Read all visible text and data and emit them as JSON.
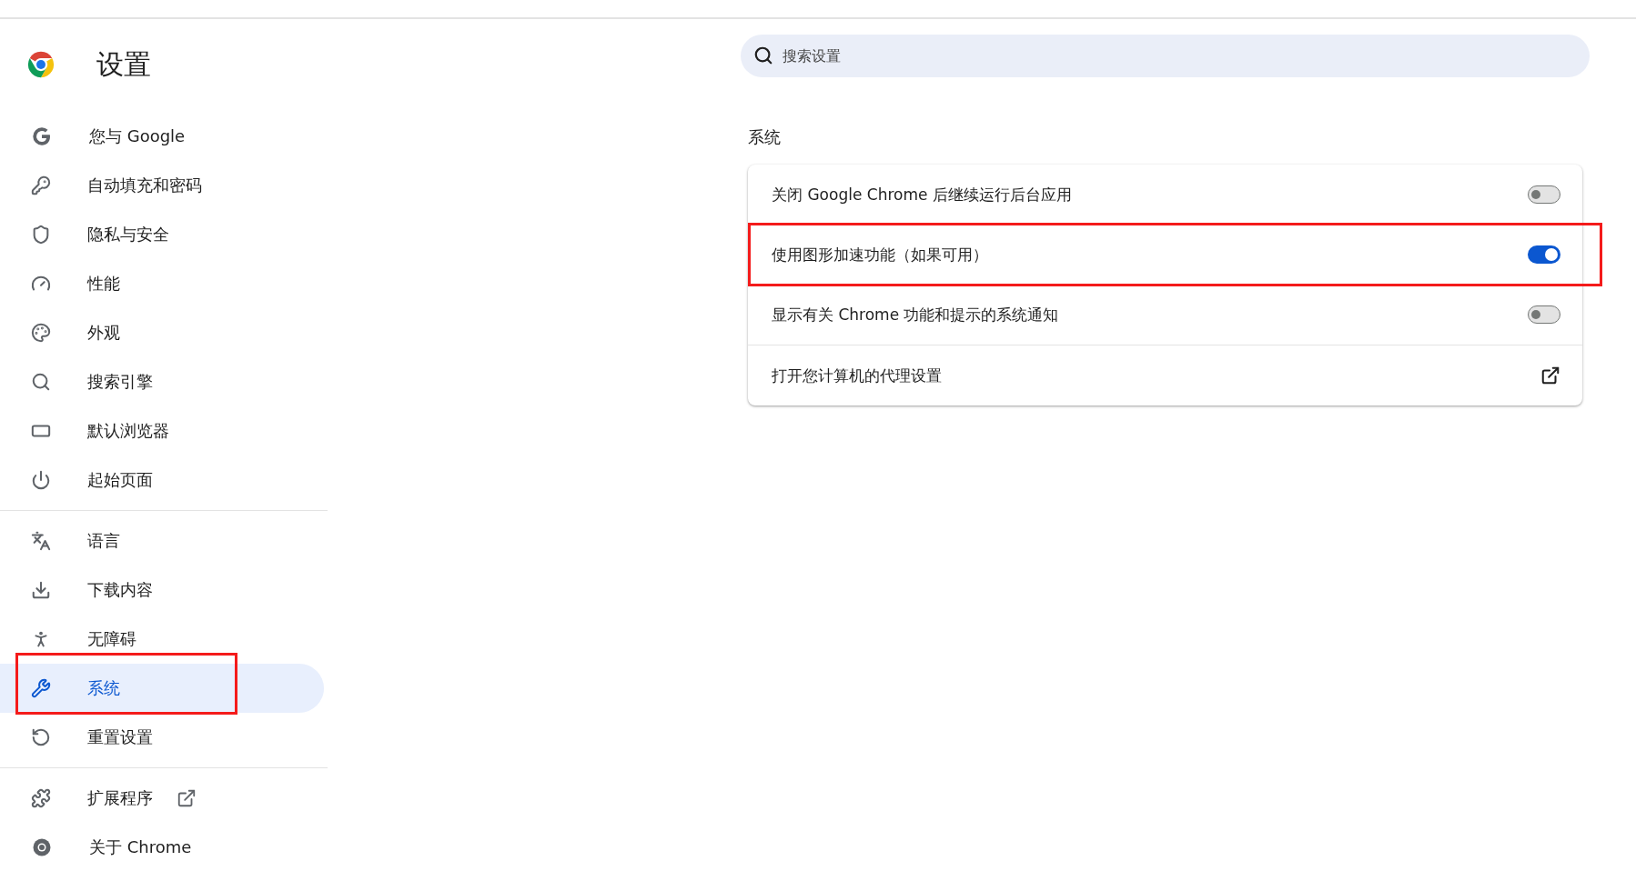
{
  "header": {
    "title": "设置"
  },
  "search": {
    "placeholder": "搜索设置"
  },
  "sidebar": {
    "groups": [
      {
        "items": [
          {
            "label": "您与 Google",
            "selected": false,
            "highlighted": false
          },
          {
            "label": "自动填充和密码",
            "selected": false,
            "highlighted": false
          },
          {
            "label": "隐私与安全",
            "selected": false,
            "highlighted": false
          },
          {
            "label": "性能",
            "selected": false,
            "highlighted": false
          },
          {
            "label": "外观",
            "selected": false,
            "highlighted": false
          },
          {
            "label": "搜索引擎",
            "selected": false,
            "highlighted": false
          },
          {
            "label": "默认浏览器",
            "selected": false,
            "highlighted": false
          },
          {
            "label": "起始页面",
            "selected": false,
            "highlighted": false
          }
        ]
      },
      {
        "items": [
          {
            "label": "语言",
            "selected": false,
            "highlighted": false
          },
          {
            "label": "下载内容",
            "selected": false,
            "highlighted": false
          },
          {
            "label": "无障碍",
            "selected": false,
            "highlighted": false
          },
          {
            "label": "系统",
            "selected": true,
            "highlighted": true
          },
          {
            "label": "重置设置",
            "selected": false,
            "highlighted": false
          }
        ]
      },
      {
        "items": [
          {
            "label": "扩展程序",
            "selected": false,
            "highlighted": false,
            "external": true
          },
          {
            "label": "关于 Chrome",
            "selected": false,
            "highlighted": false
          }
        ]
      }
    ]
  },
  "section": {
    "title": "系统",
    "rows": [
      {
        "kind": "toggle",
        "label": "关闭 Google Chrome 后继续运行后台应用",
        "on": false,
        "highlighted": false
      },
      {
        "kind": "toggle",
        "label": "使用图形加速功能（如果可用）",
        "on": true,
        "highlighted": true
      },
      {
        "kind": "toggle",
        "label": "显示有关 Chrome 功能和提示的系统通知",
        "on": false,
        "highlighted": false
      },
      {
        "kind": "link",
        "label": "打开您计算机的代理设置",
        "highlighted": false
      }
    ]
  }
}
